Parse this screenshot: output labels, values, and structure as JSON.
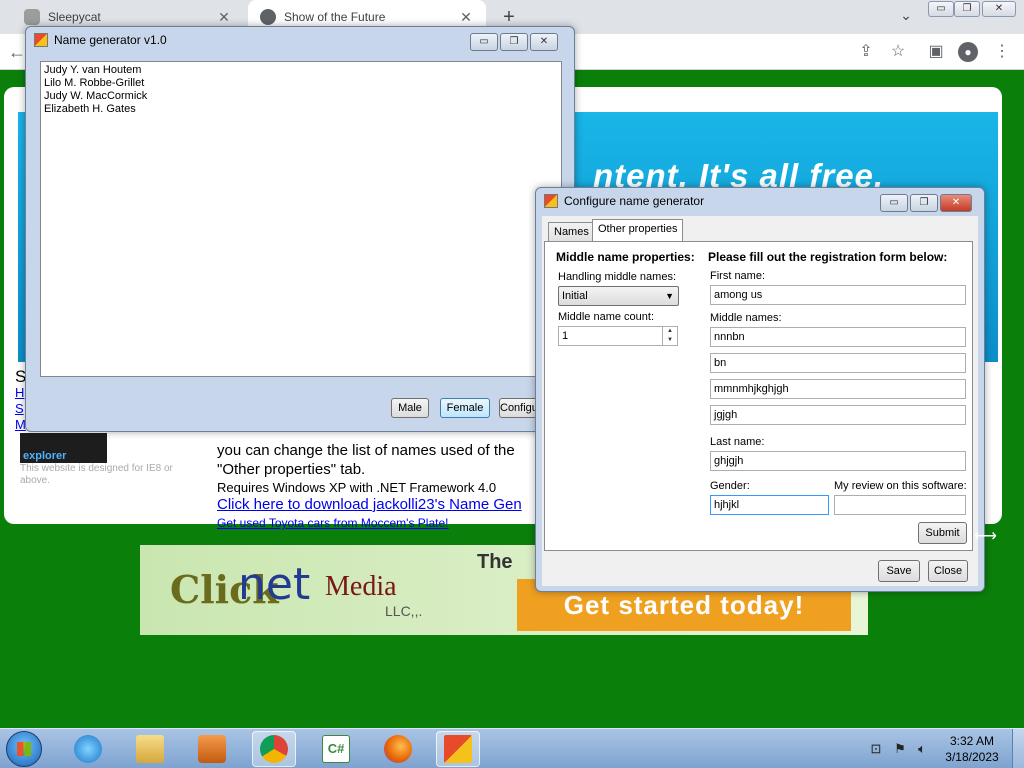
{
  "browser": {
    "tabs": [
      {
        "label": "Sleepycat",
        "icon": "cat-icon"
      },
      {
        "label": "Show of the Future",
        "icon": "globe-icon"
      }
    ],
    "new_tab": "+",
    "close_glyph": "✕"
  },
  "page": {
    "banner_text": "ntent. It's all free.",
    "left_letter": "S",
    "left_links": [
      "H",
      "S",
      "M"
    ],
    "ie_badge": "explorer",
    "ie_note": "This website is designed for IE8 or above.",
    "body_lines": [
      "you can change the list of names used of the",
      "\"Other properties\" tab.",
      "Requires Windows XP with .NET Framework 4.0"
    ],
    "download_link": "Click here to download jackolli23's Name Gen",
    "toyota_link": "Get used Toyota cars from Moccem's Plate!",
    "ad": {
      "click": "Click",
      "net": "net",
      "media": "Media",
      "llc": "LLC,,.",
      "the": "The ea",
      "cta": "Get started today!"
    }
  },
  "name_generator": {
    "title": "Name generator v1.0",
    "names": [
      "Judy Y. van Houtem",
      "Lilo M. Robbe-Grillet",
      "Judy W. MacCormick",
      "Elizabeth H. Gates"
    ],
    "buttons": {
      "male": "Male",
      "female": "Female",
      "config": "Configure"
    }
  },
  "config": {
    "title": "Configure name generator",
    "tabs": {
      "names": "Names",
      "other": "Other properties"
    },
    "middle_heading": "Middle name properties:",
    "handling_label": "Handling middle names:",
    "handling_value": "Initial",
    "count_label": "Middle name count:",
    "count_value": "1",
    "form_heading": "Please fill out the registration form below:",
    "first_name_label": "First name:",
    "first_name": "among us",
    "middle_names_label": "Middle names:",
    "middle_names": [
      "nnnbn",
      "bn",
      "mmnmhjkghjgh",
      "jgjgh"
    ],
    "last_name_label": "Last name:",
    "last_name": "ghjgjh",
    "gender_label": "Gender:",
    "gender": "hjhjkl",
    "review_label": "My review on this software:",
    "review": "",
    "submit": "Submit",
    "save": "Save",
    "close": "Close"
  },
  "window_buttons": {
    "min": "▭",
    "max": "❐",
    "close": "✕"
  },
  "taskbar": {
    "time": "3:32 AM",
    "date": "3/18/2023"
  },
  "colors": {
    "page_bg": "#0a7f0a",
    "banner": "#19b6e8",
    "link": "#0000ee"
  }
}
